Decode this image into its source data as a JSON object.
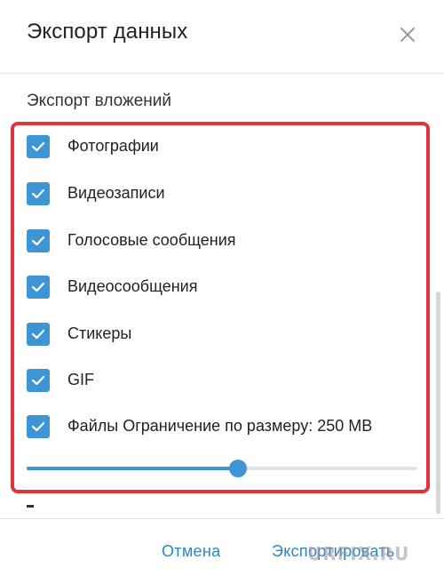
{
  "dialog": {
    "title": "Экспорт данных",
    "close_icon": "close-icon"
  },
  "section": {
    "title": "Экспорт вложений"
  },
  "options": [
    {
      "label": "Фотографии",
      "checked": true
    },
    {
      "label": "Видеозаписи",
      "checked": true
    },
    {
      "label": "Голосовые сообщения",
      "checked": true
    },
    {
      "label": "Видеосообщения",
      "checked": true
    },
    {
      "label": "Стикеры",
      "checked": true
    },
    {
      "label": "GIF",
      "checked": true
    },
    {
      "label": "Файлы Ограничение по размеру: 250 MB",
      "checked": true
    }
  ],
  "size_slider": {
    "fraction": 0.54
  },
  "footer": {
    "cancel_label": "Отмена",
    "export_label": "Экспортировать"
  },
  "watermark": "URFIX.RU",
  "colors": {
    "accent": "#3d95d6",
    "highlight_border": "#e0333a",
    "link": "#2b86c5"
  }
}
